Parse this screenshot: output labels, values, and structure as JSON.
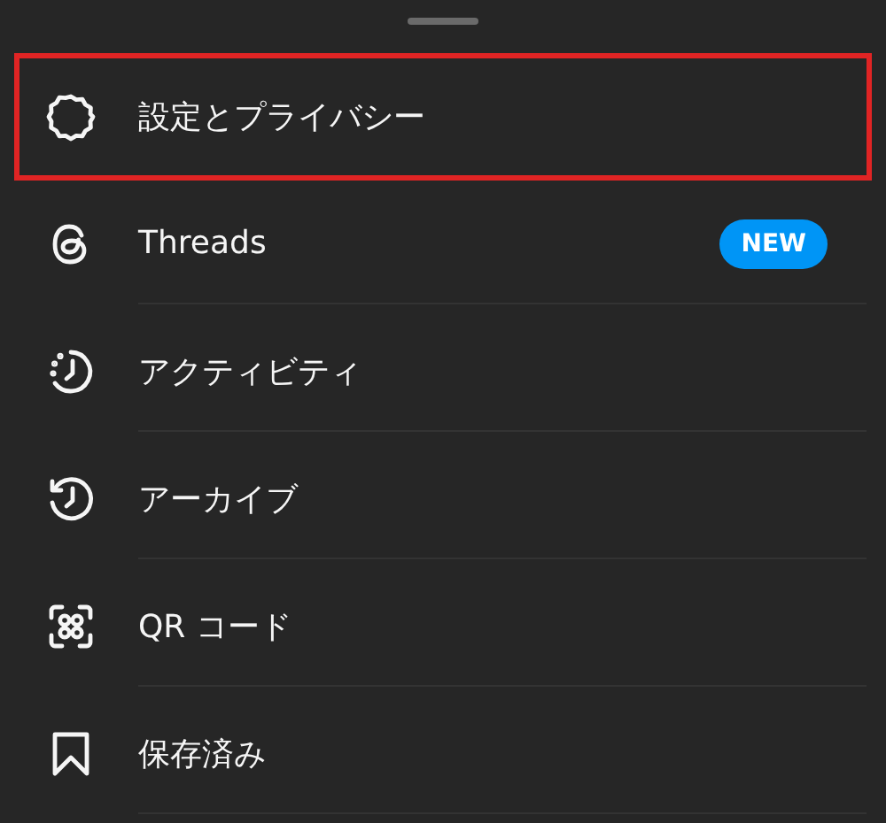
{
  "items": [
    {
      "kind": "settings",
      "label": "設定とプライバシー",
      "highlighted": true
    },
    {
      "kind": "threads",
      "label": "Threads",
      "badge": "NEW",
      "highlighted": false
    },
    {
      "kind": "activity",
      "label": "アクティビティ",
      "highlighted": false
    },
    {
      "kind": "archive",
      "label": "アーカイブ",
      "highlighted": false
    },
    {
      "kind": "qr",
      "label": "QR コード",
      "highlighted": false
    },
    {
      "kind": "saved",
      "label": "保存済み",
      "highlighted": false
    }
  ]
}
